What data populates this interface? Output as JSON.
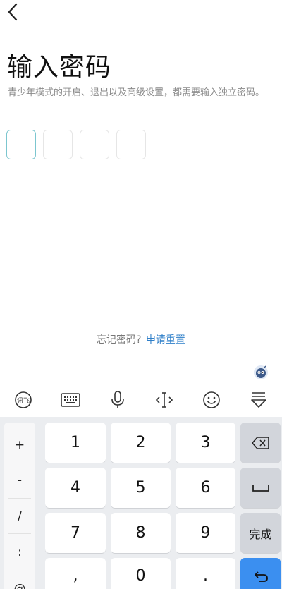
{
  "header": {
    "title": "输入密码"
  },
  "description": "青少年模式的开启、退出以及高级设置，都需要输入独立密码。",
  "pin": {
    "boxes": 4,
    "active_index": 0
  },
  "forgot": {
    "text": "忘记密码?",
    "link": "申请重置"
  },
  "toolbar": {
    "items": [
      {
        "name": "ime-logo-icon",
        "glyph": "讯飞"
      },
      {
        "name": "keyboard-icon"
      },
      {
        "name": "microphone-icon"
      },
      {
        "name": "text-cursor-icon"
      },
      {
        "name": "emoji-icon"
      },
      {
        "name": "collapse-keyboard-icon"
      }
    ]
  },
  "keyboard": {
    "symbols": [
      "+",
      "-",
      "/",
      ":",
      "@"
    ],
    "digits": [
      "1",
      "2",
      "3",
      "4",
      "5",
      "6",
      "7",
      "8",
      "9",
      ",",
      "0",
      "."
    ],
    "done_label": "完成"
  },
  "colors": {
    "accent": "#3b8ff0",
    "link": "#2f7fc9",
    "pin_active": "#7cc6cf"
  }
}
